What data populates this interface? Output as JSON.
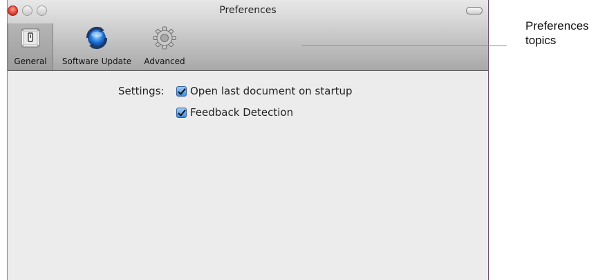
{
  "window": {
    "title": "Preferences"
  },
  "toolbar": {
    "items": [
      {
        "label": "General",
        "icon": "toggle-switch-icon",
        "selected": true
      },
      {
        "label": "Software Update",
        "icon": "update-refresh-icon",
        "selected": false
      },
      {
        "label": "Advanced",
        "icon": "gear-icon",
        "selected": false
      }
    ]
  },
  "settings": {
    "label": "Settings:",
    "options": [
      {
        "label": "Open last document on startup",
        "checked": true
      },
      {
        "label": "Feedback Detection",
        "checked": true
      }
    ]
  },
  "annotation": {
    "line1": "Preferences",
    "line2": "topics"
  },
  "colors": {
    "close_button": "#e0443a",
    "checkbox_accent": "#3f8ddf"
  }
}
